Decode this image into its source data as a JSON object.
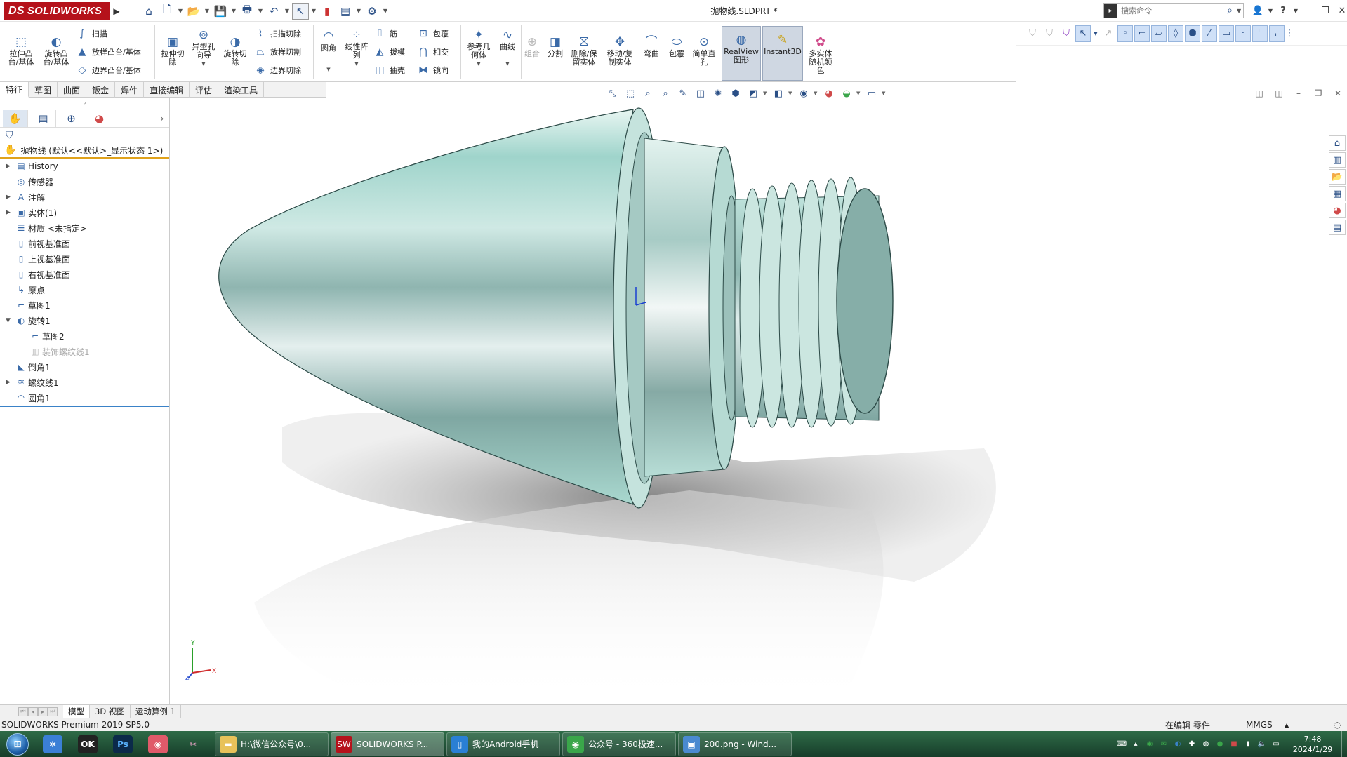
{
  "titlebar": {
    "logo_text": "SOLIDWORKS",
    "logo_prefix": "DS",
    "document_title": "抛物线.SLDPRT *",
    "search_placeholder": "搜索命令",
    "brand_color": "#b5121b"
  },
  "command_manager": {
    "extrude_boss": "拉伸凸台/基体",
    "revolve_boss": "旋转凸台/基体",
    "sweep": "扫描",
    "loft_boss": "放样凸台/基体",
    "boundary_boss": "边界凸台/基体",
    "extrude_cut": "拉伸切除",
    "hole_wizard": "异型孔向导",
    "revolve_cut": "旋转切除",
    "swept_cut": "扫描切除",
    "lofted_cut": "放样切割",
    "boundary_cut": "边界切除",
    "fillet": "圆角",
    "linear_pattern": "线性阵列",
    "rib": "筋",
    "draft": "拔模",
    "shell": "抽壳",
    "wrap": "包覆",
    "intersect": "相交",
    "mirror": "镜向",
    "ref_geometry": "参考几何体",
    "curves": "曲线",
    "combine": "组合",
    "split": "分割",
    "delete_keep_body": "删除/保留实体",
    "move_copy_body": "移动/复制实体",
    "flex": "弯曲",
    "wrap2": "包覆",
    "simple_hole": "简单直孔",
    "realview": "RealView图形",
    "instant3d": "Instant3D",
    "multibody_color": "多实体随机颜色"
  },
  "tabs": [
    "特征",
    "草图",
    "曲面",
    "钣金",
    "焊件",
    "直接编辑",
    "评估",
    "渲染工具"
  ],
  "feature_manager": {
    "root": "抛物线  (默认<<默认>_显示状态 1>)",
    "items": [
      {
        "label": "History",
        "icon": "history-icon",
        "expand": "▶"
      },
      {
        "label": "传感器",
        "icon": "sensor-icon",
        "expand": ""
      },
      {
        "label": "注解",
        "icon": "annotation-icon",
        "expand": "▶"
      },
      {
        "label": "实体(1)",
        "icon": "solid-body-icon",
        "expand": "▶"
      },
      {
        "label": "材质 <未指定>",
        "icon": "material-icon",
        "expand": ""
      },
      {
        "label": "前视基准面",
        "icon": "plane-icon",
        "expand": ""
      },
      {
        "label": "上视基准面",
        "icon": "plane-icon",
        "expand": ""
      },
      {
        "label": "右视基准面",
        "icon": "plane-icon",
        "expand": ""
      },
      {
        "label": "原点",
        "icon": "origin-icon",
        "expand": ""
      },
      {
        "label": "草图1",
        "icon": "sketch-icon",
        "expand": ""
      },
      {
        "label": "旋转1",
        "icon": "revolve-icon",
        "expand": "▼"
      },
      {
        "label": "草图2",
        "icon": "sketch-icon",
        "expand": "",
        "indent": true
      },
      {
        "label": "装饰螺纹线1",
        "icon": "cosmetic-thread-icon",
        "expand": "",
        "indent": true,
        "greyed": true
      },
      {
        "label": "倒角1",
        "icon": "chamfer-icon",
        "expand": ""
      },
      {
        "label": "螺纹线1",
        "icon": "thread-icon",
        "expand": "▶"
      },
      {
        "label": "圆角1",
        "icon": "fillet-icon",
        "expand": ""
      }
    ]
  },
  "bottom_tabs": [
    "模型",
    "3D 视图",
    "运动算例 1"
  ],
  "status": {
    "version": "SOLIDWORKS Premium 2019 SP5.0",
    "mode": "在编辑 零件",
    "units": "MMGS"
  },
  "taskbar": {
    "tasks": [
      {
        "label": "H:\\微信公众号\\0...",
        "icon": "folder-icon",
        "color": "#e8c25a"
      },
      {
        "label": "SOLIDWORKS P...",
        "icon": "solidworks-icon",
        "color": "#b5121b"
      },
      {
        "label": "我的Android手机",
        "icon": "phone-icon",
        "color": "#2a7fd4"
      },
      {
        "label": "公众号 - 360极速...",
        "icon": "browser-icon",
        "color": "#3aa64a"
      },
      {
        "label": "200.png - Wind...",
        "icon": "image-viewer-icon",
        "color": "#4a8ad0"
      }
    ],
    "time": "7:48",
    "date": "2024/1/29"
  }
}
